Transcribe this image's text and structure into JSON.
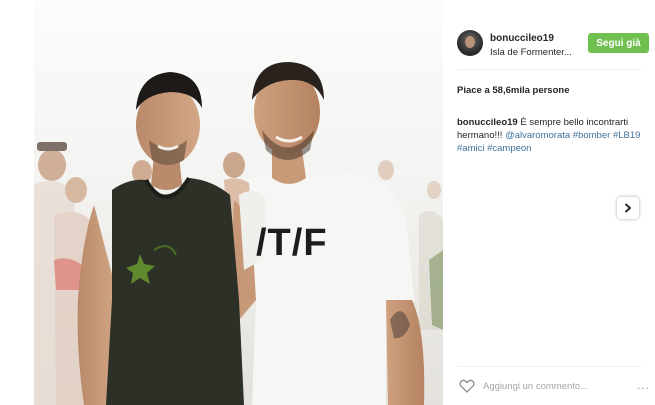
{
  "post": {
    "username": "bonuccileo19",
    "location": "Isla de Formenter...",
    "follow_label": "Segui già",
    "likes_text": "Piace a 58,6mila persone",
    "caption": {
      "user": "bonuccileo19",
      "text_before": " È sempre bello incontrarti hermano!!! ",
      "mention": "@alvaromorata",
      "tags": [
        "#bomber",
        "#LB19",
        "#amici",
        "#campeon"
      ]
    },
    "shirt_text": "/T/F",
    "comment_placeholder": "Aggiungi un commento...",
    "more_label": "..."
  },
  "icons": {
    "next": "chevron-right-icon",
    "like": "heart-icon",
    "more": "ellipsis-icon"
  },
  "colors": {
    "follow_button": "#70c050",
    "link": "#3f729b",
    "text": "#262626"
  }
}
